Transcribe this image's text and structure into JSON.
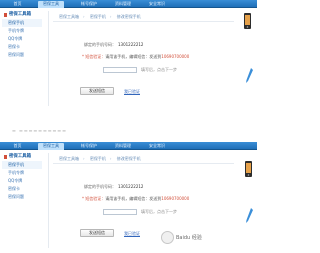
{
  "topnav": {
    "tabs": [
      {
        "label": "首页"
      },
      {
        "label": "密保工具"
      },
      {
        "label": "帐号保护"
      },
      {
        "label": "资料管理"
      },
      {
        "label": "安全常识"
      }
    ],
    "active_index": 1
  },
  "sidebar": {
    "title": "密保工具箱",
    "items": [
      {
        "label": "密保手机"
      },
      {
        "label": "手机令牌"
      },
      {
        "label": "QQ令牌"
      },
      {
        "label": "密保卡"
      },
      {
        "label": "密保问题"
      }
    ],
    "selected_index": 0
  },
  "breadcrumb": {
    "items": [
      "密保工具箱",
      "密保手机",
      "修改密保手机"
    ]
  },
  "form": {
    "current_phone_label": "绑定的手机号码：",
    "current_phone_value": "1301222212",
    "verify_label": "* 短信验证：",
    "verify_text": "请用该手机，编辑短信：",
    "verify_code": "发送到",
    "verify_number": "10690700000",
    "phone_input_value": "",
    "hint": "填写后，点击下一步"
  },
  "actions": {
    "submit_label": "发送短信",
    "link_label": "我已验证"
  },
  "strip": {
    "text": "▬ ▬▬▬▬▬▬▬▬▬▬"
  },
  "watermark": {
    "text": "Baidu 经验"
  },
  "colors": {
    "nav_bg": "#2a7fcb",
    "nav_active": "#bfe0fb",
    "accent_red": "#d24f3a",
    "link_blue": "#3366bb"
  }
}
